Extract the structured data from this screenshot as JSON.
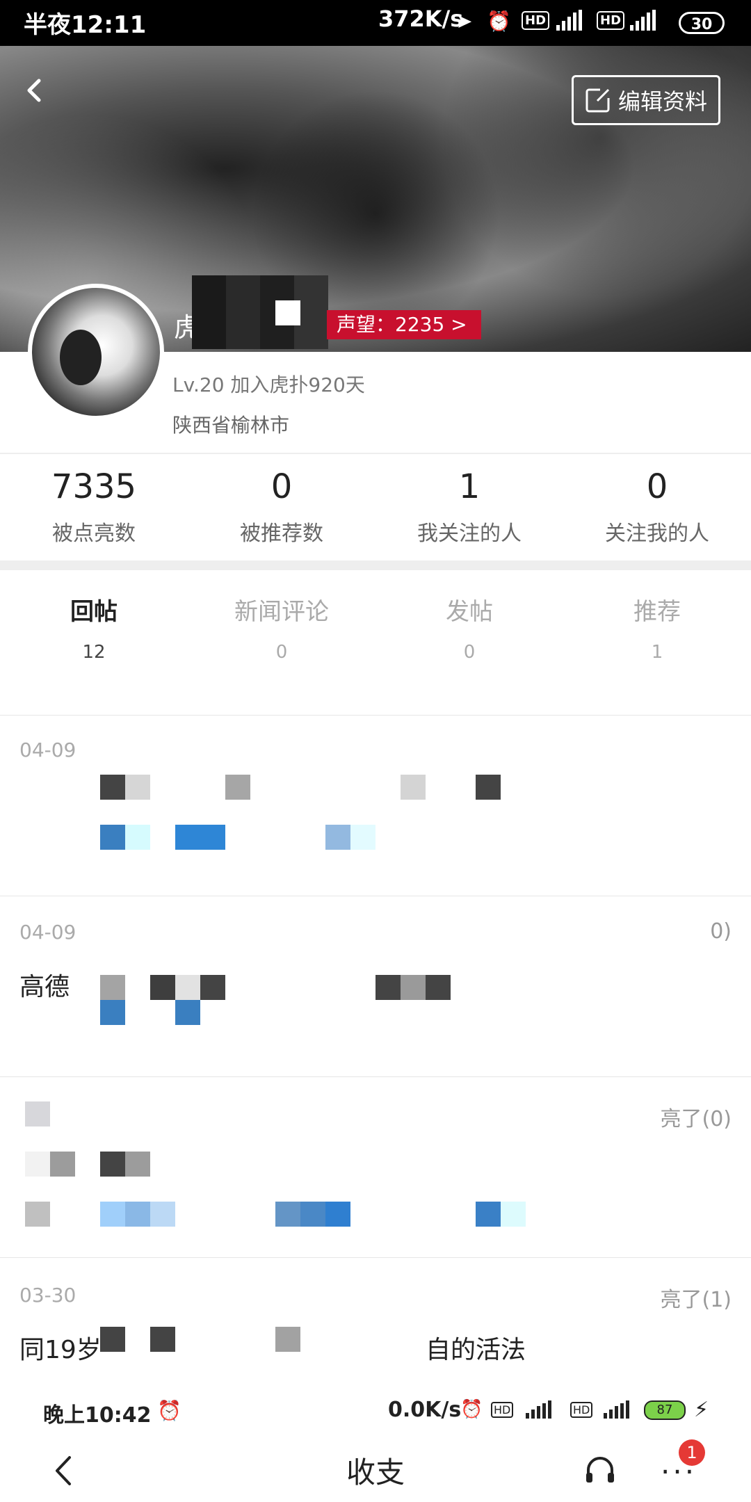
{
  "statusbar": {
    "time": "半夜12:11",
    "speed": "372K/s",
    "battery": "30"
  },
  "header": {
    "edit_label": "编辑资料",
    "username_visible": "虎",
    "reputation": "声望：2235 >"
  },
  "profile": {
    "level_join": "Lv.20  加入虎扑920天",
    "location": "陕西省榆林市"
  },
  "stats": [
    {
      "value": "7335",
      "label": "被点亮数"
    },
    {
      "value": "0",
      "label": "被推荐数"
    },
    {
      "value": "1",
      "label": "我关注的人"
    },
    {
      "value": "0",
      "label": "关注我的人"
    }
  ],
  "tabs": [
    {
      "label": "回帖",
      "count": "12"
    },
    {
      "label": "新闻评论",
      "count": "0"
    },
    {
      "label": "发帖",
      "count": "0"
    },
    {
      "label": "推荐",
      "count": "1"
    }
  ],
  "posts": [
    {
      "date": "04-09",
      "liked": "",
      "title": ""
    },
    {
      "date": "04-09",
      "liked": "0)",
      "title": "高德"
    },
    {
      "date": "",
      "liked": "亮了(0)",
      "title": ""
    },
    {
      "date": "03-30",
      "liked": "亮了(1)",
      "title": "同19岁",
      "title_tail": "自的活法"
    }
  ],
  "nested": {
    "time": "晚上10:42",
    "speed": "0.0K/s",
    "battery": "87",
    "title": "收支",
    "badge": "1"
  },
  "colors": {
    "accent": "#c8102e",
    "text": "#222222",
    "muted": "#999999",
    "link": "#2f7fd0"
  }
}
